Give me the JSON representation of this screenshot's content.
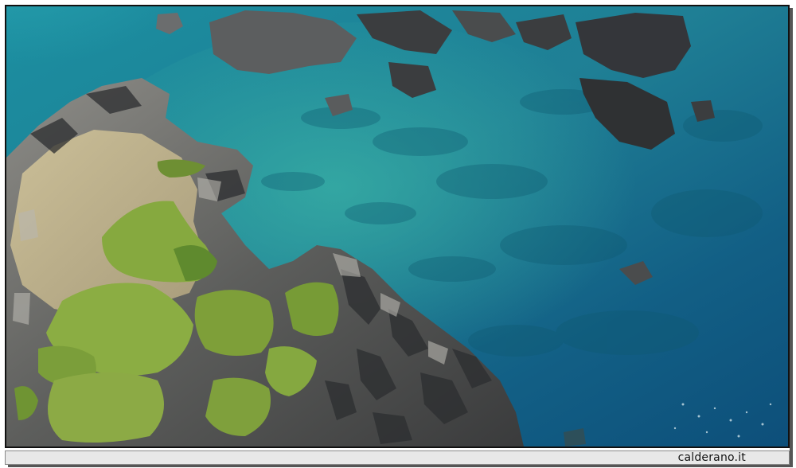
{
  "photo": {
    "subject": "aerial-coastline",
    "colors": {
      "sea_deep": "#0d4f7a",
      "sea_mid": "#1b7f95",
      "sea_shallow": "#2fa7a3",
      "rock": "#6f6f6c",
      "rock_dark": "#2f3133",
      "vegetation": "#7f9a3a",
      "sand": "#c9b990"
    }
  },
  "footer": {
    "credit": "calderano.it"
  }
}
